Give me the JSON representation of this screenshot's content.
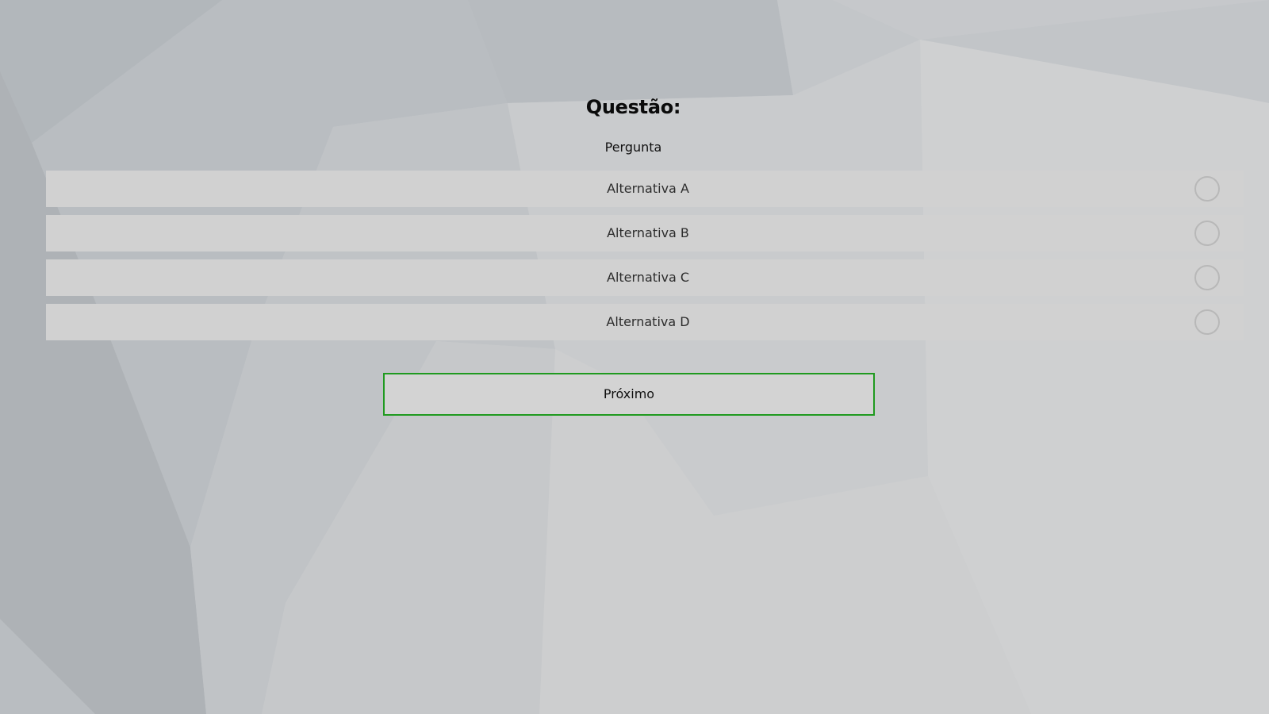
{
  "quiz": {
    "title": "Questão:",
    "question": "Pergunta",
    "options": [
      {
        "label": "Alternativa A",
        "selected": false
      },
      {
        "label": "Alternativa B",
        "selected": false
      },
      {
        "label": "Alternativa C",
        "selected": false
      },
      {
        "label": "Alternativa D",
        "selected": false
      }
    ],
    "next_label": "Próximo"
  },
  "colors": {
    "option_background": "#d1d1d1",
    "radio_border": "#b8b8b8",
    "next_button_border": "#1f9a1f",
    "background": "#c9cbcd"
  }
}
